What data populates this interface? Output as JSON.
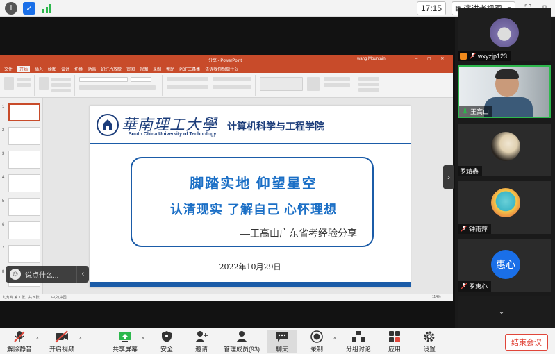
{
  "topbar": {
    "time": "17:15",
    "view_label": "演讲者视图",
    "icons": [
      "info-icon",
      "shield-icon",
      "signal-icon",
      "grid-icon",
      "fullscreen-icon",
      "window-icon"
    ]
  },
  "ppt": {
    "window_title": "分享 - PowerPoint",
    "user": "wang Mountain",
    "menu": [
      "文件",
      "开始",
      "插入",
      "绘图",
      "设计",
      "切换",
      "动画",
      "幻灯片放映",
      "审阅",
      "视图",
      "录制",
      "帮助",
      "PDF工具集",
      "告诉我你想做什么"
    ],
    "status_left": "幻灯片 第 1 张，共 8 张",
    "status_lang": "中文(中国)",
    "status_zoom": "114%"
  },
  "slide": {
    "univ_cn": "華南理工大學",
    "univ_en": "South China University of Technology",
    "college": "计算机科学与工程学院",
    "line1": "脚踏实地   仰望星空",
    "line2": "认清现实  了解自己  心怀理想",
    "line3": "—王高山广东省考经验分享",
    "date": "2022年10月29日"
  },
  "chat": {
    "placeholder": "说点什么..."
  },
  "participants": [
    {
      "name": "wxyzjp123",
      "kind": "avatar"
    },
    {
      "name": "王高山",
      "kind": "video"
    },
    {
      "name": "罗靖鑫",
      "kind": "moon"
    },
    {
      "name": "钟雨萍",
      "kind": "cartoon"
    },
    {
      "name": "罗惠心",
      "kind": "text",
      "initials": "惠心"
    }
  ],
  "toolbar": {
    "items": [
      {
        "label": "解除静音",
        "icon": "mic-muted-icon"
      },
      {
        "label": "开启视频",
        "icon": "camera-off-icon"
      },
      {
        "label": "共享屏幕",
        "icon": "share-screen-icon"
      },
      {
        "label": "安全",
        "icon": "shield-icon"
      },
      {
        "label": "邀请",
        "icon": "invite-icon"
      },
      {
        "label": "管理成员(93)",
        "icon": "members-icon"
      },
      {
        "label": "聊天",
        "icon": "chat-icon"
      },
      {
        "label": "录制",
        "icon": "record-icon"
      },
      {
        "label": "分组讨论",
        "icon": "breakout-icon"
      },
      {
        "label": "应用",
        "icon": "apps-icon"
      },
      {
        "label": "设置",
        "icon": "settings-icon"
      }
    ],
    "end_label": "结束会议"
  },
  "colors": {
    "ppt_accent": "#c84b2a",
    "slide_blue": "#1b5ca8",
    "end_red": "#e0463a"
  }
}
